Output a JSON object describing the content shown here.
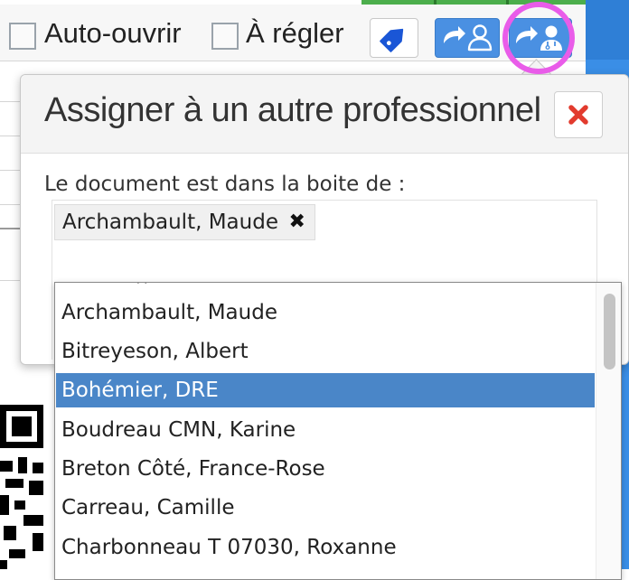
{
  "toolbar": {
    "auto_open_label": "Auto-ouvrir",
    "to_adjust_label": "À régler",
    "tag_icon": "tag-icon",
    "assign_user_icon": "assign-user-icon",
    "assign_doctor_icon": "assign-doctor-icon",
    "auto_open_checked": false,
    "to_adjust_checked": false
  },
  "modal": {
    "title": "Assigner à un autre professionnel",
    "close_icon": "close-icon",
    "label": "Le document est dans la boite de :",
    "selected_chip": "Archambault, Maude",
    "chip_remove_icon": "remove-icon"
  },
  "dropdown": {
    "items": [
      "Archambault, Maude",
      "Bitreyeson, Albert",
      "Bohémier, DRE",
      "Boudreau CMN, Karine",
      "Breton Côté, France-Rose",
      "Carreau, Camille",
      "Charbonneau T 07030, Roxanne"
    ],
    "highlighted_item": "Bohémier, DRE"
  },
  "colors": {
    "primary_blue": "#4a90e2",
    "highlight_blue": "#4a86c8",
    "close_red": "#e23b2e",
    "ring_magenta": "#e95ce9",
    "accent_green": "#4cae4c"
  }
}
